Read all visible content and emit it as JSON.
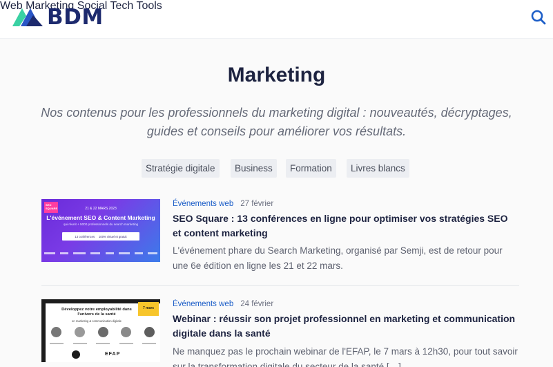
{
  "brand": {
    "logo_text": "BDM"
  },
  "nav": {
    "items": [
      "Web",
      "Marketing",
      "Social",
      "Tech",
      "Tools"
    ]
  },
  "page": {
    "title": "Marketing",
    "intro": "Nos contenus pour les professionnels du marketing digital : nouveautés, décryptages, guides et conseils pour améliorer vos résultats."
  },
  "tags": [
    "Stratégie digitale",
    "Business",
    "Formation",
    "Livres blancs"
  ],
  "articles": [
    {
      "category": "Événements web",
      "date": "27 février",
      "title": "SEO Square : 13 conférences en ligne pour optimiser vos stratégies SEO et content marketing",
      "excerpt": "L'événement phare du Search Marketing, organisé par Semji, est de retour pour une 6e édition en ligne les 21 et 22 mars.",
      "thumb": {
        "badge": "SEO SQUARE",
        "dates": "21 & 22 MARS 2023",
        "headline": "L'événement SEO & Content Marketing",
        "subline": "qui réunit + 5000 professionnels du search marketing",
        "pills": [
          "13 conférences",
          "100% virtuel et gratuit"
        ]
      }
    },
    {
      "category": "Événements web",
      "date": "24 février",
      "title": "Webinar : réussir son projet professionnel en marketing et communication digitale dans la santé",
      "excerpt": "Ne manquez pas le prochain webinar de l'EFAP, le 7 mars à 12h30, pour tout savoir sur la transformation digitale du secteur de la santé […]",
      "thumb": {
        "headline": "Développez votre employabilité dans l'univers de la santé",
        "sub": "en marketing & communication digitale",
        "date_badge": "7 mars",
        "brand": "EFAP"
      }
    }
  ],
  "colors": {
    "accent": "#1e5fc8",
    "navy": "#1d2340",
    "logo_navy": "#1d2a6e",
    "logo_green": "#3ad1a3"
  }
}
